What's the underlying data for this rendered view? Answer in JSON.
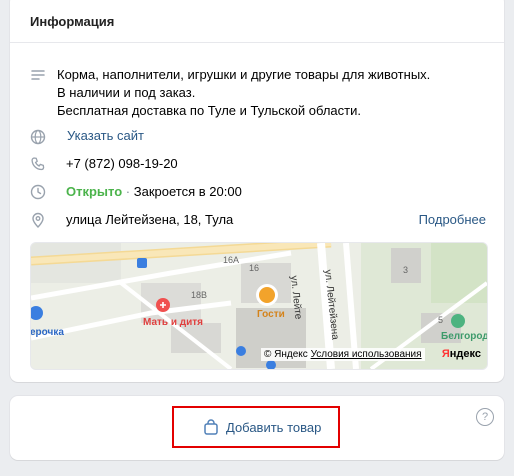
{
  "header": {
    "title": "Информация"
  },
  "description": {
    "lines": [
      "Корма, наполнители, игрушки и другие товары для животных.",
      "В наличии и под заказ.",
      "Бесплатная доставка по Туле и Тульской области."
    ]
  },
  "website": {
    "label": "Указать сайт"
  },
  "phone": {
    "value": "+7 (872) 098-19-20"
  },
  "hours": {
    "status": "Открыто",
    "separator": "·",
    "closes": "Закроется в 20:00"
  },
  "address": {
    "value": "улица Лейтейзена, 18, Тула",
    "more": "Подробнее"
  },
  "map": {
    "labels": {
      "b16a": "16А",
      "b16": "16",
      "b18b": "18В",
      "b3": "3",
      "b5": "5",
      "street1": "ул. Лейте",
      "street2": "ул. Лейтейзена"
    },
    "poi": {
      "mat": "Мать и дитя",
      "gosti": "Гости",
      "belgorod": "Белгород",
      "rochka": "ерочка"
    },
    "copyright_prefix": "© Яндекс",
    "copyright_link": "Условия использования",
    "brand_ya": "Я",
    "brand_rest": "ндекс"
  },
  "add_product": {
    "label": "Добавить товар",
    "help": "?"
  },
  "icons": [
    "list-icon",
    "globe-icon",
    "phone-icon",
    "clock-icon",
    "location-pin-icon",
    "bag-icon",
    "help-icon"
  ]
}
